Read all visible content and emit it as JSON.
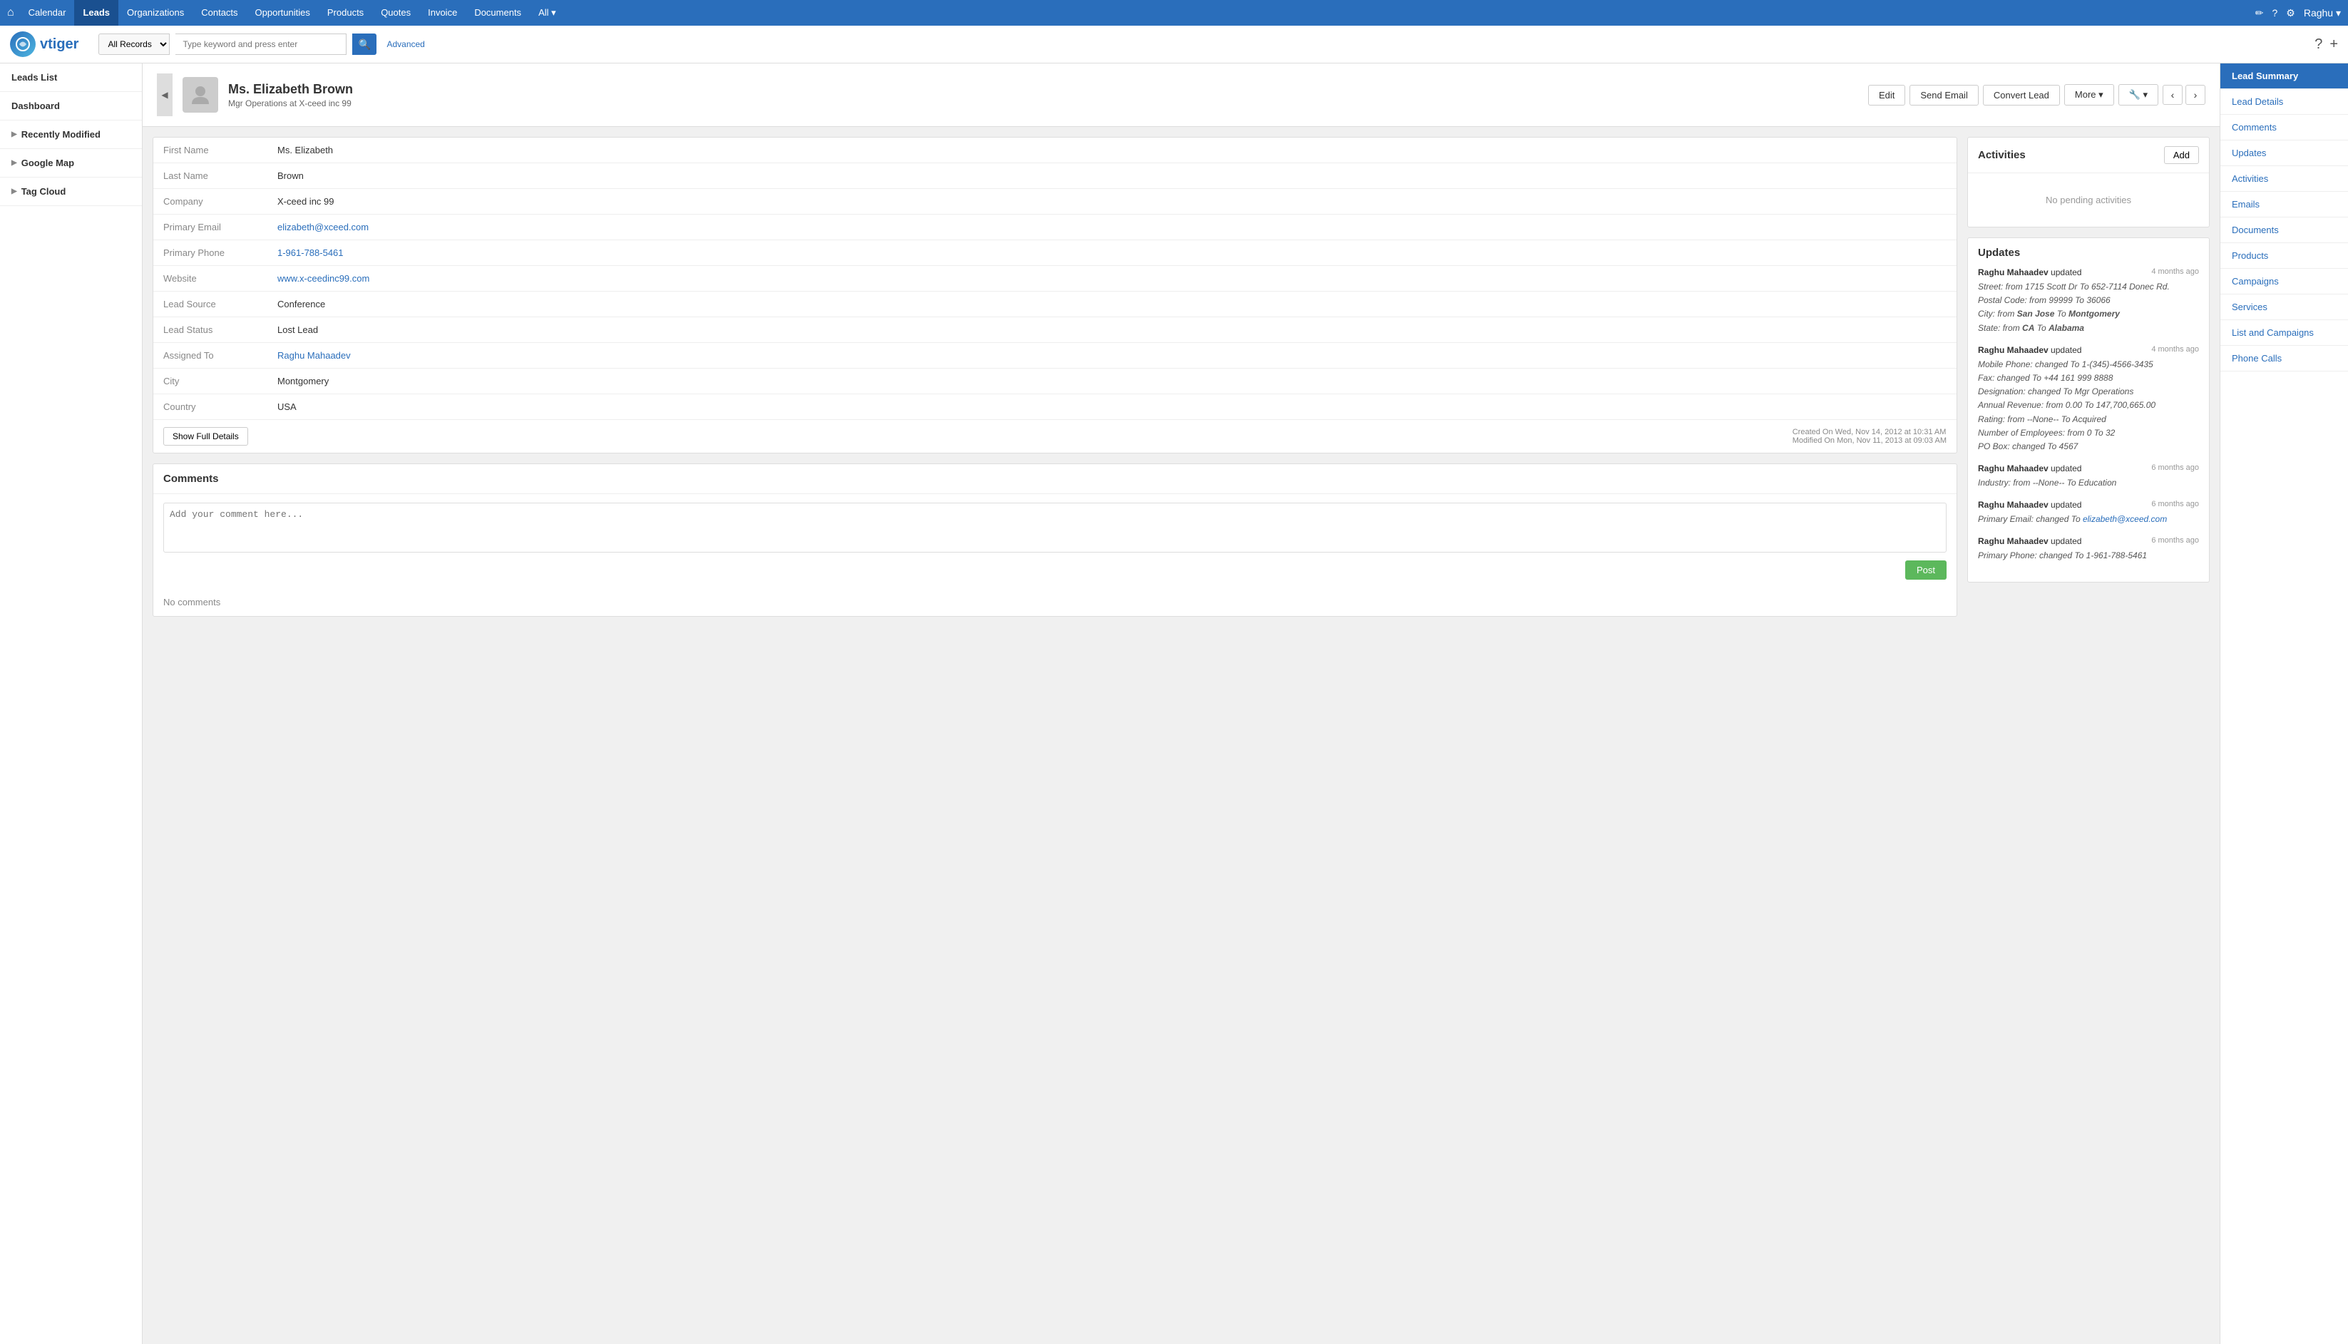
{
  "topnav": {
    "items": [
      {
        "label": "Calendar",
        "active": false
      },
      {
        "label": "Leads",
        "active": true
      },
      {
        "label": "Organizations",
        "active": false
      },
      {
        "label": "Contacts",
        "active": false
      },
      {
        "label": "Opportunities",
        "active": false
      },
      {
        "label": "Products",
        "active": false
      },
      {
        "label": "Quotes",
        "active": false
      },
      {
        "label": "Invoice",
        "active": false
      },
      {
        "label": "Documents",
        "active": false
      },
      {
        "label": "All ▾",
        "active": false
      }
    ],
    "user": "Raghu ▾"
  },
  "search": {
    "dropdown_value": "All Records",
    "placeholder": "Type keyword and press enter",
    "advanced_label": "Advanced"
  },
  "logo": {
    "text": "vtiger"
  },
  "sidebar": {
    "items": [
      {
        "label": "Leads List",
        "arrow": false
      },
      {
        "label": "Dashboard",
        "arrow": false
      },
      {
        "label": "Recently Modified",
        "arrow": true
      },
      {
        "label": "Google Map",
        "arrow": true
      },
      {
        "label": "Tag Cloud",
        "arrow": true
      }
    ]
  },
  "lead": {
    "salutation": "Ms.",
    "first_name": "Elizabeth",
    "last_name": "Brown",
    "full_name": "Ms. Elizabeth Brown",
    "subtitle": "Mgr Operations at X-ceed inc 99",
    "fields": [
      {
        "label": "First Name",
        "value": "Ms. Elizabeth",
        "type": "text"
      },
      {
        "label": "Last Name",
        "value": "Brown",
        "type": "text"
      },
      {
        "label": "Company",
        "value": "X-ceed inc 99",
        "type": "text"
      },
      {
        "label": "Primary Email",
        "value": "elizabeth@xceed.com",
        "type": "link"
      },
      {
        "label": "Primary Phone",
        "value": "1-961-788-5461",
        "type": "link"
      },
      {
        "label": "Website",
        "value": "www.x-ceedinc99.com",
        "type": "link"
      },
      {
        "label": "Lead Source",
        "value": "Conference",
        "type": "text"
      },
      {
        "label": "Lead Status",
        "value": "Lost Lead",
        "type": "text"
      },
      {
        "label": "Assigned To",
        "value": "Raghu Mahaadev",
        "type": "link"
      },
      {
        "label": "City",
        "value": "Montgomery",
        "type": "text"
      },
      {
        "label": "Country",
        "value": "USA",
        "type": "text"
      }
    ],
    "created_on": "Created On Wed, Nov 14, 2012 at 10:31 AM",
    "modified_on": "Modified On Mon, Nov 11, 2013 at 09:03 AM",
    "show_full_details_label": "Show Full Details",
    "buttons": {
      "edit": "Edit",
      "send_email": "Send Email",
      "convert_lead": "Convert Lead",
      "more": "More ▾"
    }
  },
  "activities": {
    "title": "Activities",
    "add_label": "Add",
    "no_activities": "No pending activities"
  },
  "updates": {
    "title": "Updates",
    "entries": [
      {
        "user": "Raghu Mahaadev",
        "action": "updated",
        "time": "4 months ago",
        "details": [
          "Street: from 1715 Scott Dr To 652-7114 Donec Rd.",
          "Postal Code: from 99999 To 36066",
          "City: from San Jose To Montgomery",
          "State: from CA To Alabama"
        ]
      },
      {
        "user": "Raghu Mahaadev",
        "action": "updated",
        "time": "4 months ago",
        "details": [
          "Mobile Phone: changed To 1-(345)-4566-3435",
          "Fax: changed To +44 161 999 8888",
          "Designation: changed To Mgr Operations",
          "Annual Revenue: from 0.00 To 147,700,665.00",
          "Rating: from --None-- To Acquired",
          "Number of Employees: from 0 To 32",
          "PO Box: changed To 4567"
        ]
      },
      {
        "user": "Raghu Mahaadev",
        "action": "updated",
        "time": "6 months ago",
        "details": [
          "Industry: from --None-- To Education"
        ]
      },
      {
        "user": "Raghu Mahaadev",
        "action": "updated",
        "time": "6 months ago",
        "details": [
          "Primary Email: changed To elizabeth@xceed.com"
        ]
      },
      {
        "user": "Raghu Mahaadev",
        "action": "updated",
        "time": "6 months ago",
        "details": [
          "Primary Phone: changed To 1-961-788-5461"
        ]
      }
    ]
  },
  "comments": {
    "title": "Comments",
    "placeholder": "Add your comment here...",
    "post_label": "Post",
    "no_comments": "No comments"
  },
  "right_sidebar": {
    "items": [
      "Lead Summary",
      "Lead Details",
      "Comments",
      "Updates",
      "Activities",
      "Emails",
      "Documents",
      "Products",
      "Campaigns",
      "Services",
      "List and Campaigns",
      "Phone Calls"
    ]
  }
}
